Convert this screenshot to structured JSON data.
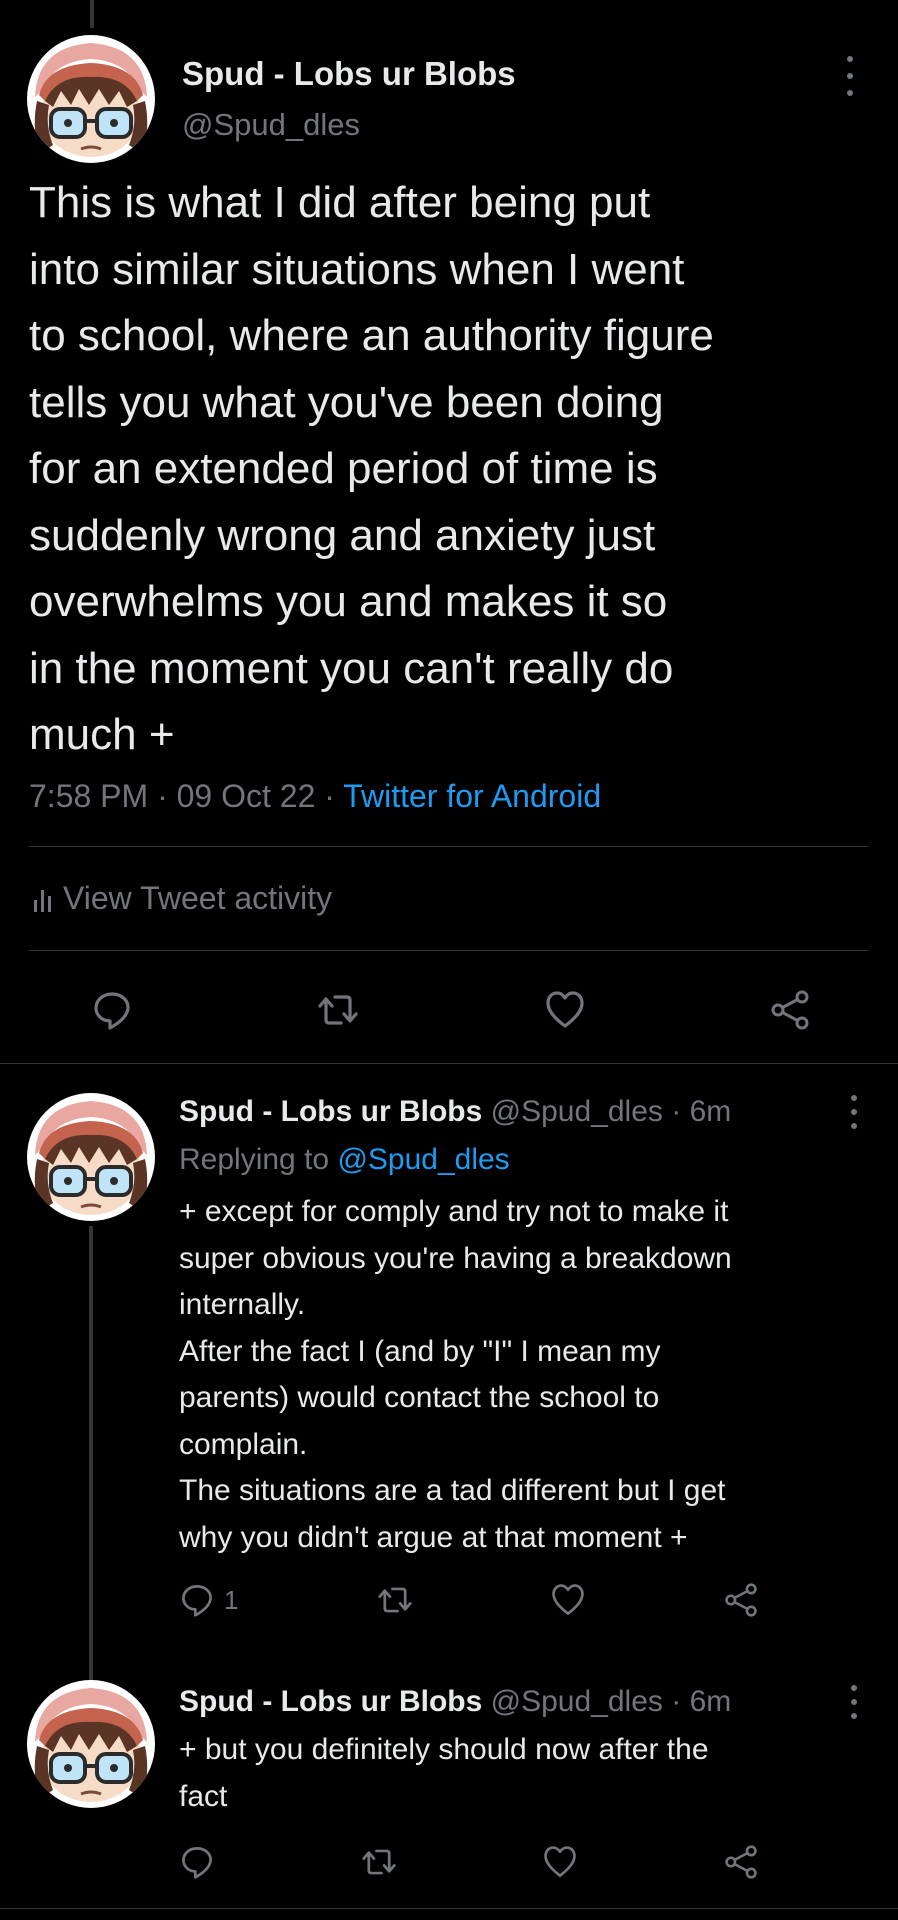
{
  "main_tweet": {
    "display_name": "Spud - Lobs ur Blobs",
    "handle": "@Spud_dles",
    "text": "This is what I did after being put\ninto similar situations when I went\nto school, where an authority figure\ntells you what you've been doing\nfor an extended period of time is\nsuddenly wrong and anxiety just\noverwhelms you and makes it so\nin the moment you can't really do\nmuch +",
    "time": "7:58 PM",
    "date": "09 Oct 22",
    "separator": "·",
    "source": "Twitter for Android",
    "activity_label": "View Tweet activity",
    "icons": [
      "reply-icon",
      "retweet-icon",
      "like-icon",
      "share-icon"
    ]
  },
  "replies": [
    {
      "display_name": "Spud - Lobs ur Blobs",
      "handle": "@Spud_dles",
      "age": "· 6m",
      "replying_prefix": "Replying to",
      "replying_to": "@Spud_dles",
      "text": "+ except for comply and try not to make it\nsuper obvious you're having a breakdown\ninternally.\nAfter the fact I (and by \"I\" I mean my\nparents) would contact the school to\ncomplain.\nThe situations are a tad different but I get\nwhy you didn't argue at that moment +",
      "reply_count": "1"
    },
    {
      "display_name": "Spud - Lobs ur Blobs",
      "handle": "@Spud_dles",
      "age": "· 6m",
      "text": "+ but you definitely should now after the\nfact",
      "reply_count": ""
    }
  ],
  "colors": {
    "background": "#000000",
    "text": "#e7e9ea",
    "muted": "#71767b",
    "link": "#1d9bf0",
    "divider": "#2f3336"
  }
}
